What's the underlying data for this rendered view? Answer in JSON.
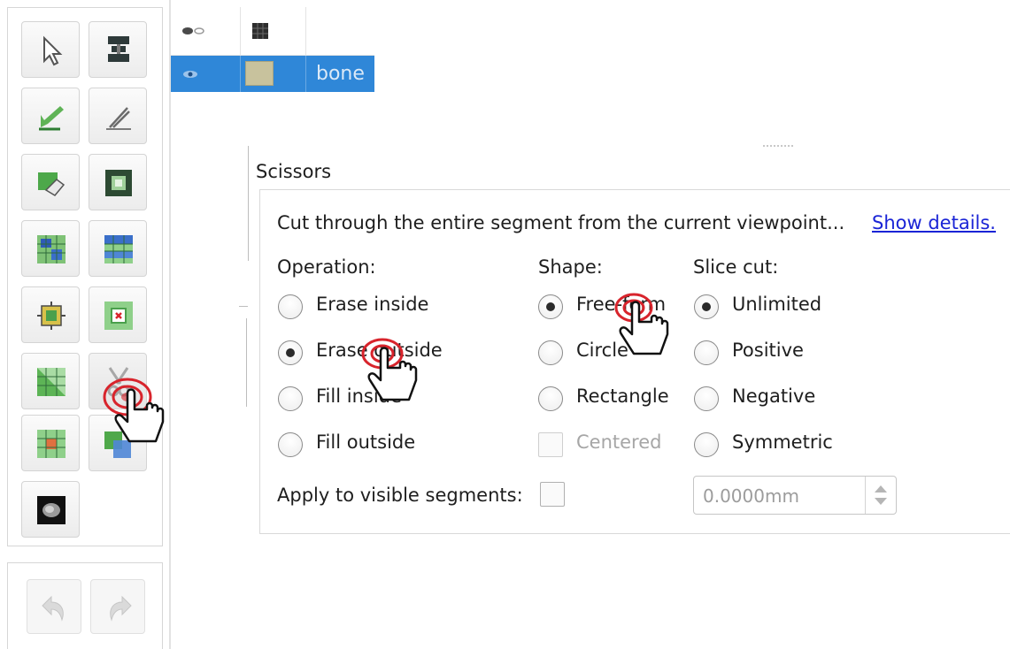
{
  "segments_table": {
    "rows": [
      {
        "name": "bone",
        "color": "#c8c29d",
        "selected": true
      }
    ]
  },
  "toolbar": {
    "tools": [
      {
        "name": "None",
        "icon": "pointer-arrow-icon",
        "active": false
      },
      {
        "name": "Threshold",
        "icon": "threshold-icon",
        "active": false
      },
      {
        "name": "Paint",
        "icon": "paint-icon",
        "active": false
      },
      {
        "name": "Draw",
        "icon": "draw-icon",
        "active": false
      },
      {
        "name": "Erase",
        "icon": "erase-icon",
        "active": false
      },
      {
        "name": "Level tracing",
        "icon": "level-tracing-icon",
        "active": false
      },
      {
        "name": "Grow from seeds",
        "icon": "grow-from-seeds-icon",
        "active": false
      },
      {
        "name": "Fill between slices",
        "icon": "fill-between-slices-icon",
        "active": false
      },
      {
        "name": "Margin",
        "icon": "margin-icon",
        "active": false
      },
      {
        "name": "Hollow",
        "icon": "hollow-icon",
        "active": false
      },
      {
        "name": "Smoothing",
        "icon": "smoothing-icon",
        "active": false
      },
      {
        "name": "Scissors",
        "icon": "scissors-icon",
        "active": true
      },
      {
        "name": "Islands",
        "icon": "islands-icon",
        "active": false
      },
      {
        "name": "Logical operators",
        "icon": "logical-operators-icon",
        "active": false
      },
      {
        "name": "Mask volume",
        "icon": "mask-volume-icon",
        "active": false
      }
    ],
    "history": [
      {
        "name": "Undo",
        "icon": "undo-icon",
        "enabled": false
      },
      {
        "name": "Redo",
        "icon": "redo-icon",
        "enabled": false
      }
    ]
  },
  "scissors": {
    "title": "Scissors",
    "description": "Cut through the entire segment from the current viewpoint...",
    "details_link": "Show details.",
    "operation": {
      "label": "Operation:",
      "options": [
        {
          "label": "Erase inside",
          "checked": false
        },
        {
          "label": "Erase outside",
          "checked": true
        },
        {
          "label": "Fill inside",
          "checked": false
        },
        {
          "label": "Fill outside",
          "checked": false
        }
      ]
    },
    "shape": {
      "label": "Shape:",
      "options": [
        {
          "label": "Free-form",
          "checked": true
        },
        {
          "label": "Circle",
          "checked": false
        },
        {
          "label": "Rectangle",
          "checked": false
        }
      ],
      "centered": {
        "label": "Centered",
        "checked": false,
        "enabled": false
      }
    },
    "slice_cut": {
      "label": "Slice cut:",
      "options": [
        {
          "label": "Unlimited",
          "checked": true
        },
        {
          "label": "Positive",
          "checked": false
        },
        {
          "label": "Negative",
          "checked": false
        },
        {
          "label": "Symmetric",
          "checked": false
        }
      ]
    },
    "apply_to_visible": {
      "label": "Apply to visible segments:",
      "checked": false
    },
    "thickness": {
      "value": "0.0000mm",
      "enabled": false
    }
  },
  "colors": {
    "selection": "#2f87d8",
    "link": "#1a24d6",
    "click_marker": "#d8242c"
  }
}
